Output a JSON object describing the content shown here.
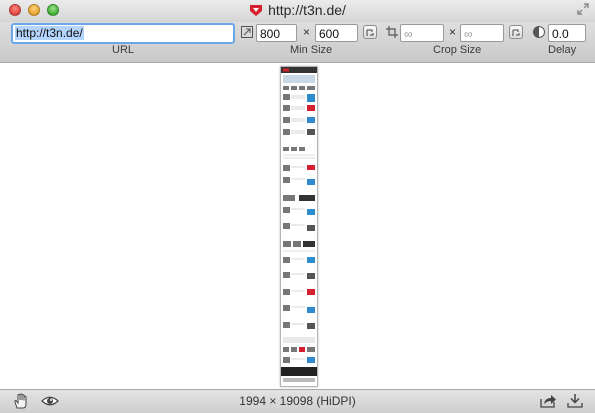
{
  "window": {
    "title": "http://t3n.de/"
  },
  "toolbar": {
    "url_value": "http://t3n.de/",
    "url_label": "URL",
    "min_size": {
      "label": "Min Size",
      "width": "800",
      "height": "600",
      "separator": "×"
    },
    "crop_size": {
      "label": "Crop Size",
      "width_placeholder": "∞",
      "height_placeholder": "∞",
      "separator": "×"
    },
    "delay": {
      "label": "Delay",
      "value": "0.0"
    }
  },
  "status": {
    "text": "1994 × 19098 (HiDPI)"
  },
  "colors": {
    "accent": "#6aa7e8",
    "favicon": "#d6202f",
    "selection": "#b3d4fc"
  },
  "icons": [
    "favicon-icon",
    "fullscreen-icon",
    "min-size-icon",
    "swap-size-icon",
    "crop-icon",
    "swap-crop-icon",
    "delay-clock-icon",
    "hand-icon",
    "eye-icon",
    "share-icon",
    "download-icon"
  ]
}
